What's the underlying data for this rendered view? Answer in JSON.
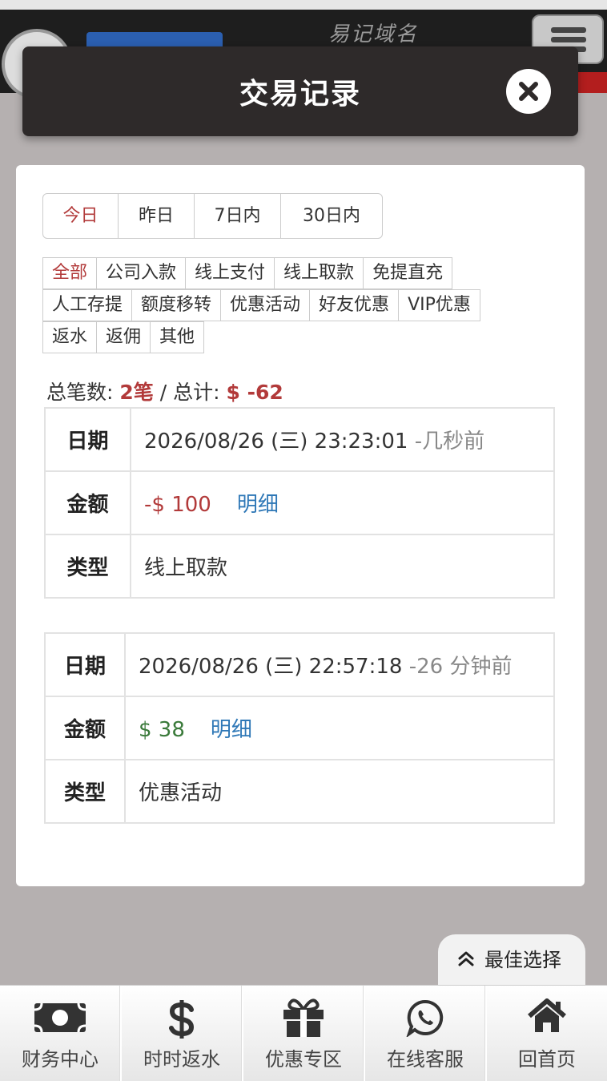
{
  "site": {
    "domain_label": "易记域名"
  },
  "modal": {
    "title": "交易记录"
  },
  "period_tabs": [
    {
      "label": "今日",
      "active": true
    },
    {
      "label": "昨日",
      "active": false
    },
    {
      "label": "7日内",
      "active": false
    },
    {
      "label": "30日内",
      "active": false
    }
  ],
  "filters": [
    [
      "全部",
      "公司入款",
      "线上支付",
      "线上取款",
      "免提直充"
    ],
    [
      "人工存提",
      "额度移转",
      "优惠活动",
      "好友优惠",
      "VIP优惠"
    ],
    [
      "返水",
      "返佣",
      "其他"
    ]
  ],
  "active_filter": "全部",
  "summary": {
    "count_label": "总笔数:",
    "count_value": "2笔",
    "separator": "/",
    "total_label": "总计:",
    "total_value": "$ -62"
  },
  "records": [
    {
      "date_label": "日期",
      "date": "2026/08/26 (三) 23:23:01",
      "ago": "-几秒前",
      "amount_label": "金额",
      "amount": "-$ 100",
      "amount_sign": "negative",
      "detail": "明细",
      "type_label": "类型",
      "type": "线上取款"
    },
    {
      "date_label": "日期",
      "date": "2026/08/26 (三) 22:57:18",
      "ago": "-26 分钟前",
      "amount_label": "金额",
      "amount": "$ 38",
      "amount_sign": "positive",
      "detail": "明细",
      "type_label": "类型",
      "type": "优惠活动"
    }
  ],
  "best_choice": "最佳选择",
  "bottom_nav": [
    {
      "label": "财务中心",
      "icon": "money-icon"
    },
    {
      "label": "时时返水",
      "icon": "dollar-icon"
    },
    {
      "label": "优惠专区",
      "icon": "gift-icon"
    },
    {
      "label": "在线客服",
      "icon": "whatsapp-icon"
    },
    {
      "label": "回首页",
      "icon": "home-icon"
    }
  ],
  "colors": {
    "accent_red": "#b23a3a",
    "positive_green": "#3a7a3a",
    "link_blue": "#2f78b7",
    "modal_bar": "#2e2a2a"
  }
}
